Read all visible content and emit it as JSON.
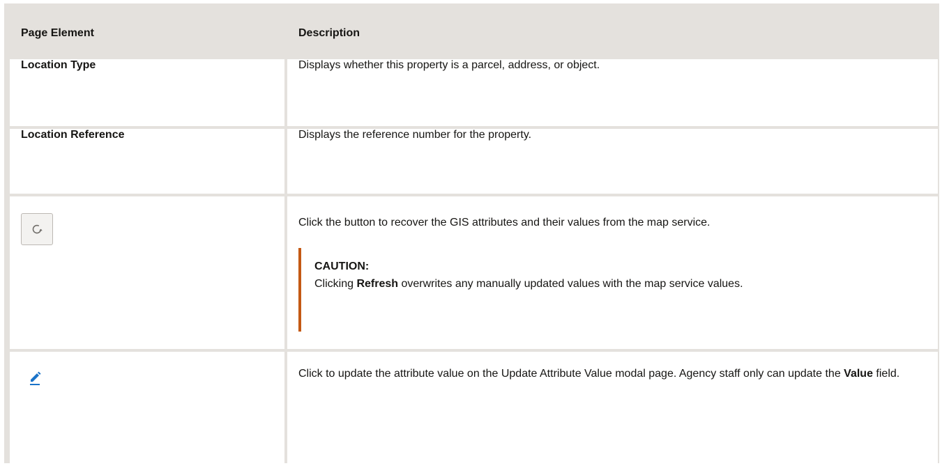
{
  "table": {
    "headers": [
      "Page Element",
      "Description"
    ],
    "rows": {
      "location_type": {
        "element": "Location Type",
        "description": "Displays whether this property is a parcel, address, or object."
      },
      "location_reference": {
        "element": "Location Reference",
        "description": "Displays the reference number for the property."
      },
      "refresh": {
        "icon": "refresh-icon",
        "description": "Click the button to recover the GIS attributes and their values from the map service.",
        "caution_title": "CAUTION:",
        "caution_pre": "Clicking ",
        "caution_bold": "Refresh",
        "caution_post": " overwrites any manually updated values with the map service values."
      },
      "edit": {
        "icon": "pencil-icon",
        "description_pre": "Click to update the attribute value on the Update Attribute Value modal page. Agency staff only can update the ",
        "description_bold": "Value",
        "description_post": " field."
      }
    }
  },
  "colors": {
    "caution_bar": "#c45914",
    "edit_icon": "#1a73c8",
    "border": "#e4e1dd"
  }
}
